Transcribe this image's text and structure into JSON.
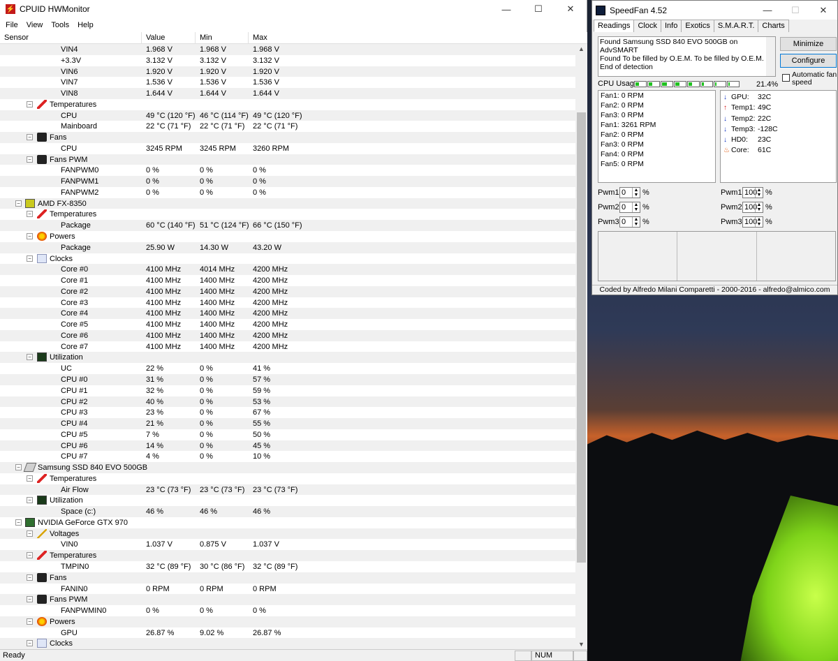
{
  "hwmonitor": {
    "title": "CPUID HWMonitor",
    "menu": [
      "File",
      "View",
      "Tools",
      "Help"
    ],
    "columns": [
      "Sensor",
      "Value",
      "Min",
      "Max"
    ],
    "rows": [
      {
        "level": 3,
        "label": "VIN4",
        "value": "1.968 V",
        "min": "1.968 V",
        "max": "1.968 V"
      },
      {
        "level": 3,
        "label": "+3.3V",
        "value": "3.132 V",
        "min": "3.132 V",
        "max": "3.132 V"
      },
      {
        "level": 3,
        "label": "VIN6",
        "value": "1.920 V",
        "min": "1.920 V",
        "max": "1.920 V"
      },
      {
        "level": 3,
        "label": "VIN7",
        "value": "1.536 V",
        "min": "1.536 V",
        "max": "1.536 V"
      },
      {
        "level": 3,
        "label": "VIN8",
        "value": "1.644 V",
        "min": "1.644 V",
        "max": "1.644 V"
      },
      {
        "level": 2,
        "label": "Temperatures",
        "icon": "therm"
      },
      {
        "level": 3,
        "label": "CPU",
        "value": "49 °C  (120 °F)",
        "min": "46 °C  (114 °F)",
        "max": "49 °C  (120 °F)"
      },
      {
        "level": 3,
        "label": "Mainboard",
        "value": "22 °C  (71 °F)",
        "min": "22 °C  (71 °F)",
        "max": "22 °C  (71 °F)"
      },
      {
        "level": 2,
        "label": "Fans",
        "icon": "fan"
      },
      {
        "level": 3,
        "label": "CPU",
        "value": "3245 RPM",
        "min": "3245 RPM",
        "max": "3260 RPM"
      },
      {
        "level": 2,
        "label": "Fans PWM",
        "icon": "fan"
      },
      {
        "level": 3,
        "label": "FANPWM0",
        "value": "0 %",
        "min": "0 %",
        "max": "0 %"
      },
      {
        "level": 3,
        "label": "FANPWM1",
        "value": "0 %",
        "min": "0 %",
        "max": "0 %"
      },
      {
        "level": 3,
        "label": "FANPWM2",
        "value": "0 %",
        "min": "0 %",
        "max": "0 %"
      },
      {
        "level": 1,
        "label": "AMD FX-8350",
        "icon": "cpu"
      },
      {
        "level": 2,
        "label": "Temperatures",
        "icon": "therm"
      },
      {
        "level": 3,
        "label": "Package",
        "value": "60 °C  (140 °F)",
        "min": "51 °C  (124 °F)",
        "max": "66 °C  (150 °F)"
      },
      {
        "level": 2,
        "label": "Powers",
        "icon": "power"
      },
      {
        "level": 3,
        "label": "Package",
        "value": "25.90 W",
        "min": "14.30 W",
        "max": "43.20 W"
      },
      {
        "level": 2,
        "label": "Clocks",
        "icon": "clock"
      },
      {
        "level": 3,
        "label": "Core #0",
        "value": "4100 MHz",
        "min": "4014 MHz",
        "max": "4200 MHz"
      },
      {
        "level": 3,
        "label": "Core #1",
        "value": "4100 MHz",
        "min": "1400 MHz",
        "max": "4200 MHz"
      },
      {
        "level": 3,
        "label": "Core #2",
        "value": "4100 MHz",
        "min": "1400 MHz",
        "max": "4200 MHz"
      },
      {
        "level": 3,
        "label": "Core #3",
        "value": "4100 MHz",
        "min": "1400 MHz",
        "max": "4200 MHz"
      },
      {
        "level": 3,
        "label": "Core #4",
        "value": "4100 MHz",
        "min": "1400 MHz",
        "max": "4200 MHz"
      },
      {
        "level": 3,
        "label": "Core #5",
        "value": "4100 MHz",
        "min": "1400 MHz",
        "max": "4200 MHz"
      },
      {
        "level": 3,
        "label": "Core #6",
        "value": "4100 MHz",
        "min": "1400 MHz",
        "max": "4200 MHz"
      },
      {
        "level": 3,
        "label": "Core #7",
        "value": "4100 MHz",
        "min": "1400 MHz",
        "max": "4200 MHz"
      },
      {
        "level": 2,
        "label": "Utilization",
        "icon": "util"
      },
      {
        "level": 3,
        "label": "UC",
        "value": "22 %",
        "min": "0 %",
        "max": "41 %"
      },
      {
        "level": 3,
        "label": "CPU #0",
        "value": "31 %",
        "min": "0 %",
        "max": "57 %"
      },
      {
        "level": 3,
        "label": "CPU #1",
        "value": "32 %",
        "min": "0 %",
        "max": "59 %"
      },
      {
        "level": 3,
        "label": "CPU #2",
        "value": "40 %",
        "min": "0 %",
        "max": "53 %"
      },
      {
        "level": 3,
        "label": "CPU #3",
        "value": "23 %",
        "min": "0 %",
        "max": "67 %"
      },
      {
        "level": 3,
        "label": "CPU #4",
        "value": "21 %",
        "min": "0 %",
        "max": "55 %"
      },
      {
        "level": 3,
        "label": "CPU #5",
        "value": "7 %",
        "min": "0 %",
        "max": "50 %"
      },
      {
        "level": 3,
        "label": "CPU #6",
        "value": "14 %",
        "min": "0 %",
        "max": "45 %"
      },
      {
        "level": 3,
        "label": "CPU #7",
        "value": "4 %",
        "min": "0 %",
        "max": "10 %"
      },
      {
        "level": 1,
        "label": "Samsung SSD 840 EVO 500GB",
        "icon": "ssd"
      },
      {
        "level": 2,
        "label": "Temperatures",
        "icon": "therm"
      },
      {
        "level": 3,
        "label": "Air Flow",
        "value": "23 °C  (73 °F)",
        "min": "23 °C  (73 °F)",
        "max": "23 °C  (73 °F)"
      },
      {
        "level": 2,
        "label": "Utilization",
        "icon": "util"
      },
      {
        "level": 3,
        "label": "Space (c:)",
        "value": "46 %",
        "min": "46 %",
        "max": "46 %"
      },
      {
        "level": 1,
        "label": "NVIDIA GeForce GTX 970",
        "icon": "gpu"
      },
      {
        "level": 2,
        "label": "Voltages",
        "icon": "volt"
      },
      {
        "level": 3,
        "label": "VIN0",
        "value": "1.037 V",
        "min": "0.875 V",
        "max": "1.037 V"
      },
      {
        "level": 2,
        "label": "Temperatures",
        "icon": "therm"
      },
      {
        "level": 3,
        "label": "TMPIN0",
        "value": "32 °C  (89 °F)",
        "min": "30 °C  (86 °F)",
        "max": "32 °C  (89 °F)"
      },
      {
        "level": 2,
        "label": "Fans",
        "icon": "fan"
      },
      {
        "level": 3,
        "label": "FANIN0",
        "value": "0 RPM",
        "min": "0 RPM",
        "max": "0 RPM"
      },
      {
        "level": 2,
        "label": "Fans PWM",
        "icon": "fan"
      },
      {
        "level": 3,
        "label": "FANPWMIN0",
        "value": "0 %",
        "min": "0 %",
        "max": "0 %"
      },
      {
        "level": 2,
        "label": "Powers",
        "icon": "power"
      },
      {
        "level": 3,
        "label": "GPU",
        "value": "26.87 %",
        "min": "9.02 %",
        "max": "26.87 %"
      },
      {
        "level": 2,
        "label": "Clocks",
        "icon": "clock"
      }
    ],
    "status": "Ready",
    "num": "NUM"
  },
  "speedfan": {
    "title": "SpeedFan 4.52",
    "tabs": [
      "Readings",
      "Clock",
      "Info",
      "Exotics",
      "S.M.A.R.T.",
      "Charts"
    ],
    "log": [
      "Found Samsung SSD 840 EVO 500GB on AdvSMART",
      "Found To be filled by O.E.M. To be filled by O.E.M.",
      "End of detection"
    ],
    "minimize_label": "Minimize",
    "configure_label": "Configure",
    "auto_fan_label_1": "Automatic fan",
    "auto_fan_label_2": "speed",
    "cpu_usage_label": "CPU Usage",
    "cpu_usage_pct": "21.4%",
    "cpu_meters": [
      0.3,
      0.3,
      0.45,
      0.35,
      0.3,
      0.2,
      0.05,
      0.1
    ],
    "fans": [
      "Fan1: 0 RPM",
      "Fan2: 0 RPM",
      "Fan3: 0 RPM",
      "Fan1: 3261 RPM",
      "Fan2: 0 RPM",
      "Fan3: 0 RPM",
      "Fan4: 0 RPM",
      "Fan5: 0 RPM"
    ],
    "temps": [
      {
        "arrow": "down",
        "name": "GPU:",
        "value": "32C"
      },
      {
        "arrow": "up",
        "name": "Temp1:",
        "value": "49C"
      },
      {
        "arrow": "down",
        "name": "Temp2:",
        "value": "22C"
      },
      {
        "arrow": "down",
        "name": "Temp3:",
        "value": "-128C"
      },
      {
        "arrow": "down",
        "name": "HD0:",
        "value": "23C"
      },
      {
        "arrow": "fire",
        "name": "Core:",
        "value": "61C"
      }
    ],
    "pwm_left": [
      {
        "label": "Pwm1:",
        "value": "0"
      },
      {
        "label": "Pwm2:",
        "value": "0"
      },
      {
        "label": "Pwm3:",
        "value": "0"
      }
    ],
    "pwm_right": [
      {
        "label": "Pwm1:",
        "value": "100"
      },
      {
        "label": "Pwm2:",
        "value": "100"
      },
      {
        "label": "Pwm3:",
        "value": "100"
      }
    ],
    "pct_sign": "%",
    "footer": "Coded by Alfredo Milani Comparetti - 2000-2016 - alfredo@almico.com"
  }
}
